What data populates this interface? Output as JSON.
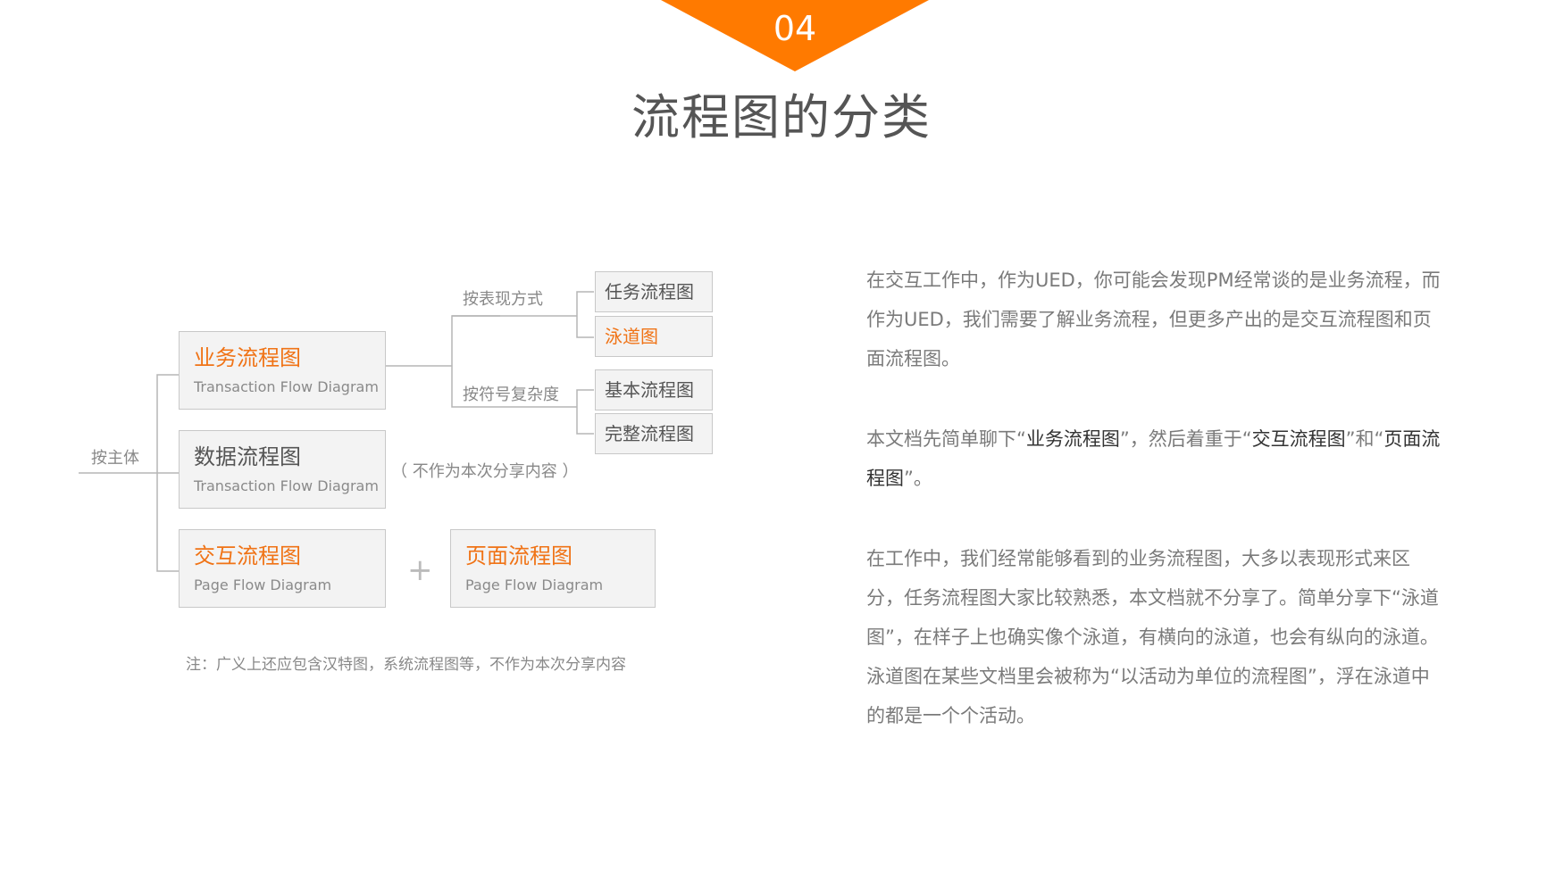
{
  "header": {
    "section_number": "04",
    "title": "流程图的分类",
    "accent_color": "#ff7a00"
  },
  "diagram": {
    "root_label": "按主体",
    "cards": [
      {
        "cn": "业务流程图",
        "en": "Transaction Flow Diagram",
        "highlight": true
      },
      {
        "cn": "数据流程图",
        "en": "Transaction Flow Diagram",
        "highlight": false
      },
      {
        "cn": "交互流程图",
        "en": "Page Flow Diagram",
        "highlight": true
      },
      {
        "cn": "页面流程图",
        "en": "Page Flow Diagram",
        "highlight": true
      }
    ],
    "data_flow_note": "（ 不作为本次分享内容 ）",
    "plus_symbol": "+",
    "branch_labels": [
      "按表现方式",
      "按符号复杂度"
    ],
    "leaves": [
      {
        "label": "任务流程图",
        "highlight": false
      },
      {
        "label": "泳道图",
        "highlight": true
      },
      {
        "label": "基本流程图",
        "highlight": false
      },
      {
        "label": "完整流程图",
        "highlight": false
      }
    ],
    "footnote": "注：广义上还应包含汉特图，系统流程图等，不作为本次分享内容"
  },
  "description": {
    "paragraph1": "在交互工作中，作为UED，你可能会发现PM经常谈的是业务流程，而作为UED，我们需要了解业务流程，但更多产出的是交互流程图和页面流程图。",
    "paragraph2_parts": [
      "本文档先简单聊下“",
      "业务流程图",
      "”，然后着重于“",
      "交互流程图",
      "”和“",
      "页面流程图",
      "”。"
    ],
    "paragraph3": "在工作中，我们经常能够看到的业务流程图，大多以表现形式来区分，任务流程图大家比较熟悉，本文档就不分享了。简单分享下“泳道图”，在样子上也确实像个泳道，有横向的泳道，也会有纵向的泳道。泳道图在某些文档里会被称为“以活动为单位的流程图”，浮在泳道中的都是一个个活动。"
  }
}
